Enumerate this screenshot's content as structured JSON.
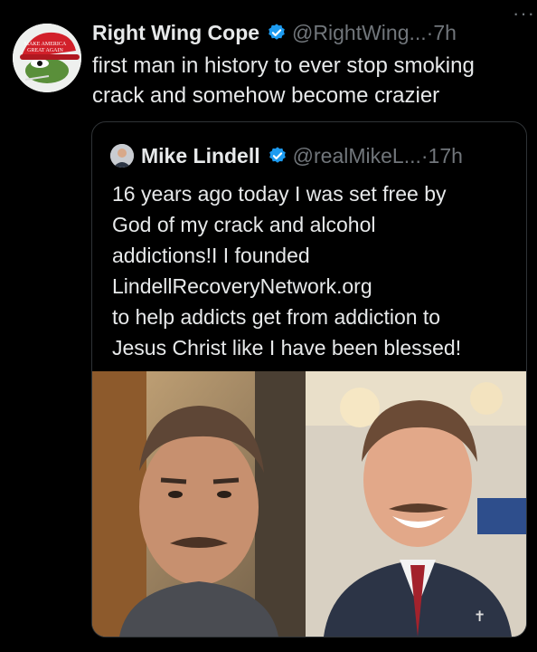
{
  "tweet": {
    "display_name": "Right Wing Cope",
    "handle": "@RightWing...",
    "dot": "·",
    "time": "7h",
    "more_icon": "more-icon",
    "text_lines": [
      "first man in history to ever stop smoking",
      "crack and somehow become crazier"
    ]
  },
  "quote": {
    "display_name": "Mike Lindell",
    "handle": "@realMikeL...",
    "dot": "·",
    "time": "17h",
    "text_lines": [
      "16 years ago today I was set free by",
      "God of my crack and alcohol",
      "addictions!I I founded",
      "LindellRecoveryNetwork.org",
      "to help addicts get from addiction to",
      "Jesus Christ like I have been blessed!"
    ]
  },
  "colors": {
    "background": "#000000",
    "text": "#e7e9ea",
    "secondary": "#71767b",
    "verified": "#1d9bf0",
    "border": "#2f3336"
  }
}
